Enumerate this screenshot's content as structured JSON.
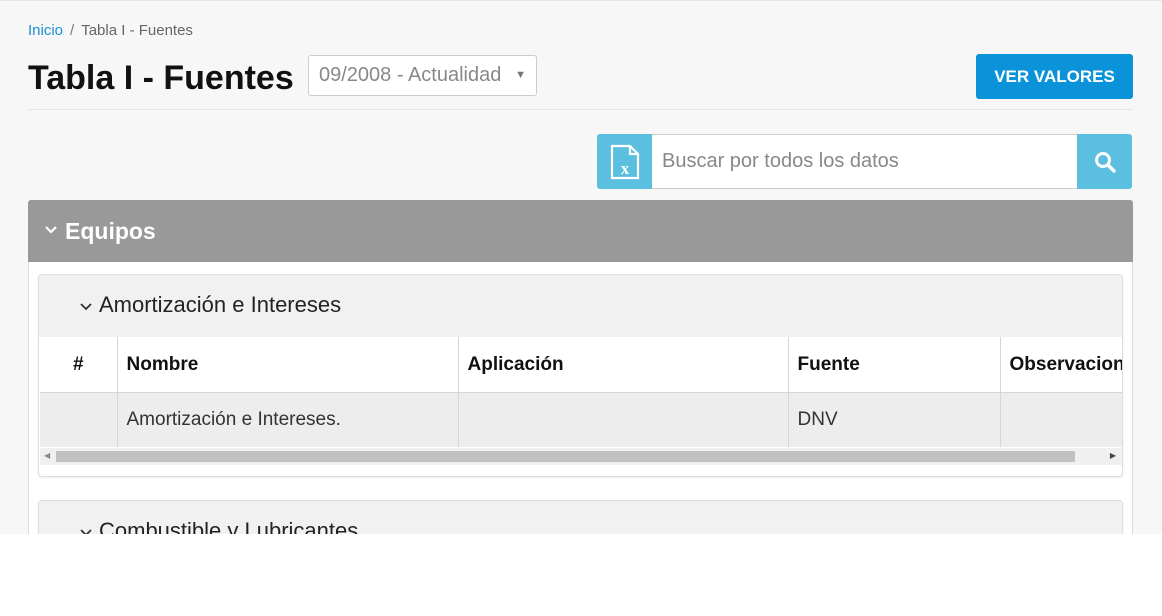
{
  "breadcrumb": {
    "home": "Inicio",
    "separator": "/",
    "current": "Tabla I - Fuentes"
  },
  "header": {
    "title": "Tabla I - Fuentes",
    "period_select": "09/2008 - Actualidad",
    "ver_valores": "VER VALORES"
  },
  "search": {
    "placeholder": "Buscar por todos los datos",
    "excel_icon": "excel-file-icon",
    "search_icon": "magnifier-icon"
  },
  "section": {
    "title": "Equipos",
    "panels": [
      {
        "title": "Amortización e Intereses",
        "columns": [
          "#",
          "Nombre",
          "Aplicación",
          "Fuente",
          "Observaciones"
        ],
        "rows": [
          [
            "",
            "Amortización e Intereses.",
            "",
            "DNV",
            ""
          ]
        ]
      },
      {
        "title": "Combustible y Lubricantes"
      }
    ]
  },
  "colors": {
    "link": "#1a8fd6",
    "primary_button": "#0a93d9",
    "search_accent": "#5bbfdf",
    "section_header": "#999999"
  }
}
